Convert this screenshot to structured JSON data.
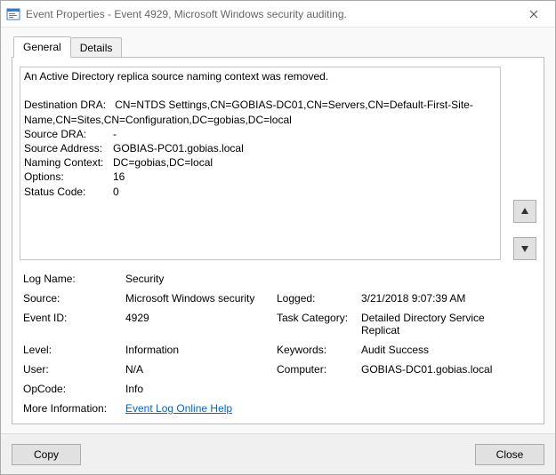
{
  "window": {
    "title": "Event Properties - Event 4929, Microsoft Windows security auditing."
  },
  "tabs": {
    "general": "General",
    "details": "Details"
  },
  "message": {
    "summary": "An Active Directory replica source naming context was removed.",
    "dest_dra_label": "Destination DRA:",
    "dest_dra_value": "CN=NTDS Settings,CN=GOBIAS-DC01,CN=Servers,CN=Default-First-Site-Name,CN=Sites,CN=Configuration,DC=gobias,DC=local",
    "source_dra_label": "Source DRA:",
    "source_dra_value": "-",
    "source_addr_label": "Source Address:",
    "source_addr_value": "GOBIAS-PC01.gobias.local",
    "naming_ctx_label": "Naming Context:",
    "naming_ctx_value": "DC=gobias,DC=local",
    "options_label": "Options:",
    "options_value": "16",
    "status_label": "Status Code:",
    "status_value": "0"
  },
  "fields": {
    "log_name_label": "Log Name:",
    "log_name": "Security",
    "source_label": "Source:",
    "source": "Microsoft Windows security",
    "logged_label": "Logged:",
    "logged": "3/21/2018 9:07:39 AM",
    "event_id_label": "Event ID:",
    "event_id": "4929",
    "task_category_label": "Task Category:",
    "task_category": "Detailed Directory Service Replicat",
    "level_label": "Level:",
    "level": "Information",
    "keywords_label": "Keywords:",
    "keywords": "Audit Success",
    "user_label": "User:",
    "user": "N/A",
    "computer_label": "Computer:",
    "computer": "GOBIAS-DC01.gobias.local",
    "opcode_label": "OpCode:",
    "opcode": "Info",
    "more_info_label": "More Information:",
    "more_info_link": "Event Log Online Help"
  },
  "buttons": {
    "copy": "Copy",
    "close": "Close"
  }
}
